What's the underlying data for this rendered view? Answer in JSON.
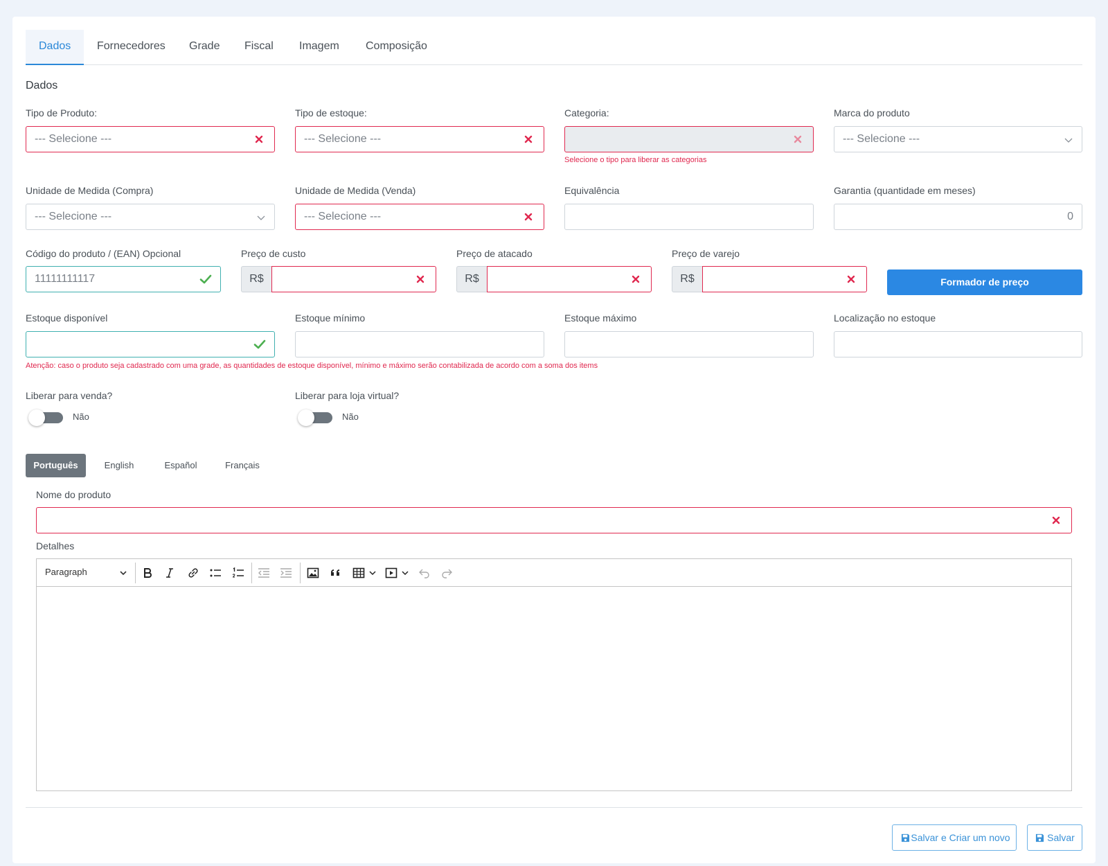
{
  "tabs": [
    "Dados",
    "Fornecedores",
    "Grade",
    "Fiscal",
    "Imagem",
    "Composição"
  ],
  "section_title": "Dados",
  "select_placeholder": "--- Selecione ---",
  "labels": {
    "tipo_produto": "Tipo de Produto:",
    "tipo_estoque": "Tipo de estoque:",
    "categoria": "Categoria:",
    "marca": "Marca do produto",
    "um_compra": "Unidade de Medida (Compra)",
    "um_venda": "Unidade de Medida (Venda)",
    "equivalencia": "Equivalência",
    "garantia": "Garantia (quantidade em meses)",
    "codigo": "Código do produto / (EAN) Opcional",
    "preco_custo": "Preço de custo",
    "preco_atacado": "Preço de atacado",
    "preco_varejo": "Preço de varejo",
    "estoque_disp": "Estoque disponível",
    "estoque_min": "Estoque mínimo",
    "estoque_max": "Estoque máximo",
    "localizacao": "Localização no estoque",
    "liberar_venda": "Liberar para venda?",
    "liberar_loja": "Liberar para loja virtual?",
    "nome_produto": "Nome do produto",
    "detalhes": "Detalhes"
  },
  "values": {
    "garantia": "0",
    "codigo": "11111111117",
    "currency": "R$",
    "toggle_off": "Não"
  },
  "help": {
    "categoria": "Selecione o tipo para liberar as categorias",
    "estoque": "Atenção: caso o produto seja cadastrado com uma grade, as quantidades de estoque disponível, mínimo e máximo serão contabilizada de acordo com a soma dos items"
  },
  "buttons": {
    "formador": "Formador de preço",
    "salvar_novo": "Salvar e Criar um novo",
    "salvar": "Salvar"
  },
  "languages": [
    "Português",
    "English",
    "Español",
    "Français"
  ],
  "editor": {
    "paragraph": "Paragraph"
  },
  "colors": {
    "primary": "#2b88e3",
    "error": "#e0284f",
    "success": "#4caf50",
    "tab_active": "#2b88d8"
  }
}
